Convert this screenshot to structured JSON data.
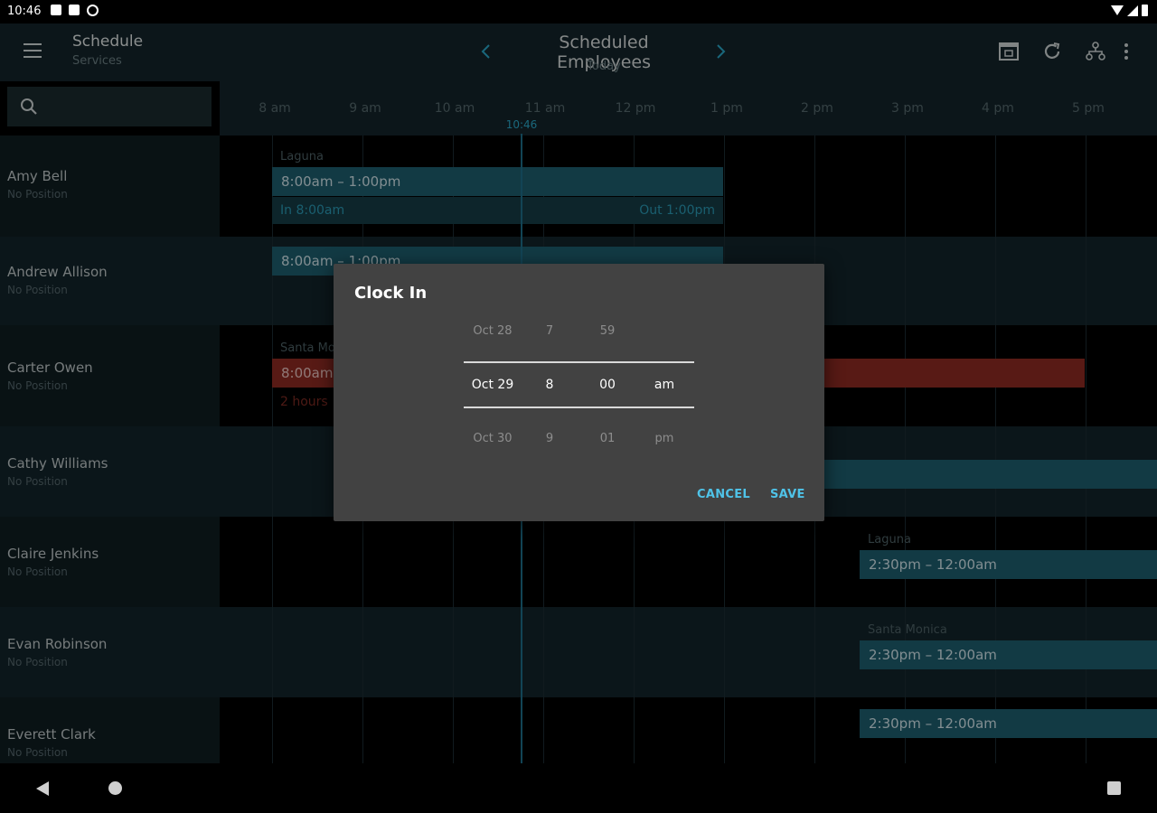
{
  "status_bar": {
    "time": "10:46"
  },
  "app_bar": {
    "title": "Schedule",
    "subtitle": "Services",
    "center_title": "Scheduled Employees",
    "center_subtitle": "Today",
    "prev_icon": "chevron-left-icon",
    "next_icon": "chevron-right-icon",
    "icons": [
      "calendar-icon",
      "refresh-icon",
      "org-chart-icon",
      "more-vert-icon"
    ]
  },
  "search": {
    "icon": "search-icon",
    "placeholder": ""
  },
  "timeline": {
    "hours": [
      "8 am",
      "9 am",
      "10 am",
      "11 am",
      "12 pm",
      "1 pm",
      "2 pm",
      "3 pm",
      "4 pm",
      "5 pm"
    ],
    "now_label": "10:46"
  },
  "employees": [
    {
      "name": "Amy Bell",
      "position": "No Position",
      "location": "Laguna",
      "shift": "8:00am – 1:00pm",
      "punch_in": "In  8:00am",
      "punch_out": "Out  1:00pm"
    },
    {
      "name": "Andrew Allison",
      "position": "No Position",
      "location": "",
      "shift": "8:00am – 1:00pm"
    },
    {
      "name": "Carter Owen",
      "position": "No Position",
      "location": "Santa Monica",
      "shift": "8:00am",
      "overdue": "2 hours"
    },
    {
      "name": "Cathy Williams",
      "position": "No Position"
    },
    {
      "name": "Claire Jenkins",
      "position": "No Position",
      "location": "Laguna",
      "shift": "2:30pm – 12:00am"
    },
    {
      "name": "Evan Robinson",
      "position": "No Position",
      "location": "Santa Monica",
      "shift": "2:30pm – 12:00am"
    },
    {
      "name": "Everett Clark",
      "position": "No Position",
      "location": "",
      "shift": "2:30pm – 12:00am"
    }
  ],
  "dialog": {
    "title": "Clock In",
    "picker": {
      "above": {
        "date": "Oct 28",
        "hour": "7",
        "minute": "59",
        "ampm": ""
      },
      "selected": {
        "date": "Oct 29",
        "hour": "8",
        "minute": "00",
        "ampm": "am"
      },
      "below": {
        "date": "Oct 30",
        "hour": "9",
        "minute": "01",
        "ampm": "pm"
      }
    },
    "cancel_label": "CANCEL",
    "save_label": "SAVE"
  },
  "colors": {
    "accent": "#2aa7c8",
    "shift": "#1e5e6e",
    "late_shift": "#8e2a22",
    "background": "#0f1d21"
  }
}
